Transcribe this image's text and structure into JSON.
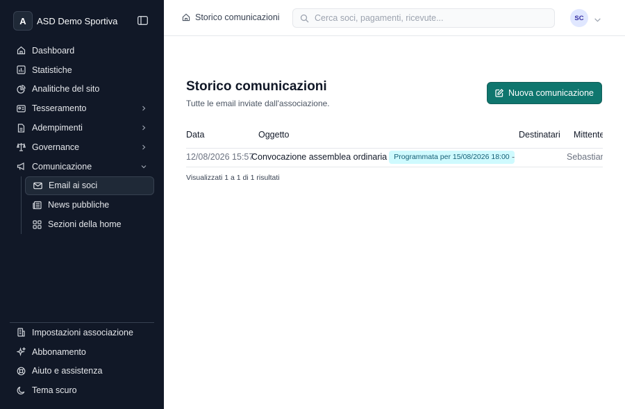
{
  "org": {
    "initial": "A",
    "name": "ASD Demo Sportiva"
  },
  "sidebar": {
    "items": [
      {
        "label": "Dashboard",
        "icon": "home-icon"
      },
      {
        "label": "Statistiche",
        "icon": "chart-icon"
      },
      {
        "label": "Analitiche del sito",
        "icon": "pie-icon"
      },
      {
        "label": "Tesseramento",
        "icon": "id-card-icon",
        "has_children": true
      },
      {
        "label": "Adempimenti",
        "icon": "file-icon",
        "has_children": true
      },
      {
        "label": "Governance",
        "icon": "scale-icon",
        "has_children": true
      },
      {
        "label": "Comunicazione",
        "icon": "megaphone-icon",
        "expanded": true
      }
    ],
    "sub_items": [
      {
        "label": "Email ai soci",
        "icon": "mail-icon",
        "active": true
      },
      {
        "label": "News pubbliche",
        "icon": "newspaper-icon"
      },
      {
        "label": "Sezioni della home",
        "icon": "grid-icon"
      }
    ],
    "bottom_items": [
      {
        "label": "Impostazioni associazione",
        "icon": "building-icon"
      },
      {
        "label": "Abbonamento",
        "icon": "sparkles-icon"
      },
      {
        "label": "Aiuto e assistenza",
        "icon": "lifebuoy-icon"
      },
      {
        "label": "Tema scuro",
        "icon": "moon-icon"
      }
    ]
  },
  "header": {
    "breadcrumb": "Storico comunicazioni",
    "search_placeholder": "Cerca soci, pagamenti, ricevute...",
    "user_initials": "SC"
  },
  "main": {
    "title": "Storico comunicazioni",
    "subtitle": "Tutte le email inviate dall'associazione.",
    "new_button": "Nuova comunicazione",
    "table": {
      "columns": [
        "Data",
        "Oggetto",
        "Destinatari",
        "Mittente"
      ],
      "rows": [
        {
          "date": "12/08/2026 15:57",
          "subject": "Convocazione assemblea ordinaria",
          "badge": "Programmata per 15/08/2026 18:00",
          "recipients": "-",
          "sender": "Sebastiano"
        }
      ]
    },
    "results_text": "Visualizzati 1 a 1 di 1 risultati"
  },
  "colors": {
    "sidebar_bg": "#111827",
    "accent": "#0f766e",
    "badge_bg": "#cffafe",
    "badge_text": "#155e75"
  }
}
